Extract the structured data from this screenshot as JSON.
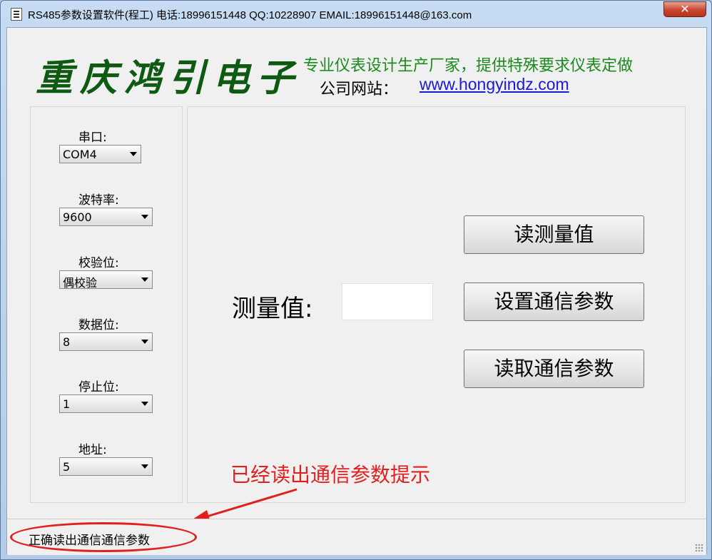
{
  "window": {
    "title": "RS485参数设置软件(程工)  电话:18996151448  QQ:10228907  EMAIL:18996151448@163.com"
  },
  "header": {
    "logo_text": "重庆鸿引电子",
    "slogan": "专业仪表设计生产厂家，提供特殊要求仪表定做",
    "website_label": "公司网站：",
    "website_url": "www.hongyindz.com"
  },
  "settings": {
    "port_label": "串口:",
    "port_value": "COM4",
    "baud_label": "波特率:",
    "baud_value": "9600",
    "parity_label": "校验位:",
    "parity_value": "偶校验",
    "databits_label": "数据位:",
    "databits_value": "8",
    "stopbits_label": "停止位:",
    "stopbits_value": "1",
    "address_label": "地址:",
    "address_value": "5"
  },
  "main": {
    "measure_label": "测量值:",
    "measure_value": "",
    "read_measure_button": "读测量值",
    "set_params_button": "设置通信参数",
    "read_params_button": "读取通信参数"
  },
  "annotation": {
    "text": "已经读出通信参数提示"
  },
  "status": {
    "text": "正确读出通信通信参数"
  },
  "colors": {
    "annotation": "#e21f1f",
    "logo": "#0f5a12",
    "slogan": "#1c8a1c",
    "link": "#1a1ad6"
  }
}
